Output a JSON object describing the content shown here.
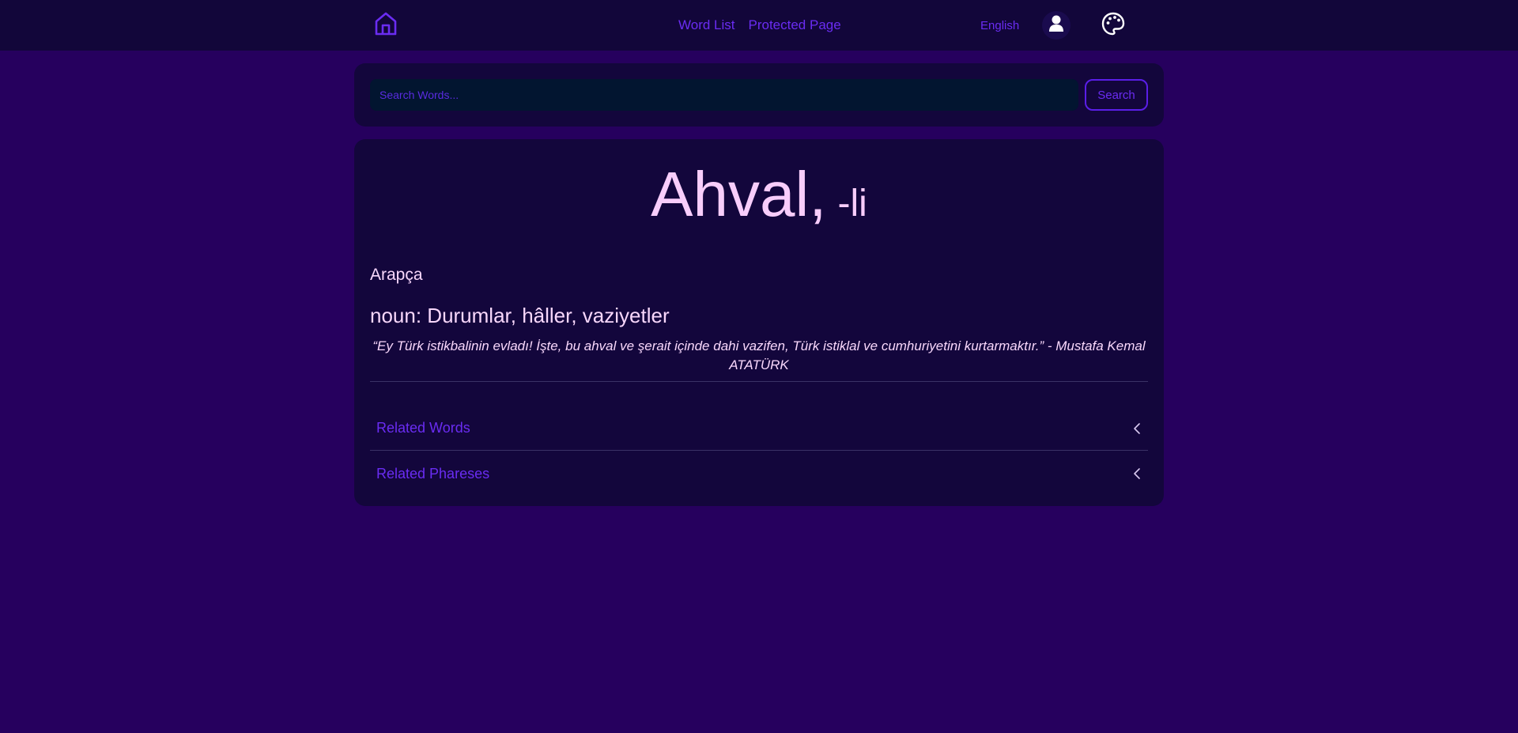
{
  "nav": {
    "links": [
      {
        "label": "Word List"
      },
      {
        "label": "Protected Page"
      }
    ],
    "language": "English"
  },
  "search": {
    "placeholder": "Search Words...",
    "button_label": "Search"
  },
  "word": {
    "title": "Ahval,",
    "suffix": "-li",
    "origin": "Arapça",
    "definition": "noun: Durumlar, hâller, vaziyetler",
    "quote": "“Ey Türk istikbalinin evladı! İşte, bu ahval ve şerait içinde dahi vazifen, Türk istiklal ve cumhuriyetini kurtarmaktır.” - Mustafa Kemal ATATÜRK"
  },
  "sections": [
    {
      "label": "Related Words"
    },
    {
      "label": "Related Phareses"
    }
  ],
  "colors": {
    "background": "#26005e",
    "navbar": "#12063a",
    "card": "#13063c",
    "accent": "#6a2cf2",
    "text": "#f8d7fb",
    "input_bg": "#021530"
  },
  "icons": {
    "home": "home-icon",
    "user": "user-icon",
    "theme": "palette-icon",
    "expand": "chevron-left-icon"
  }
}
